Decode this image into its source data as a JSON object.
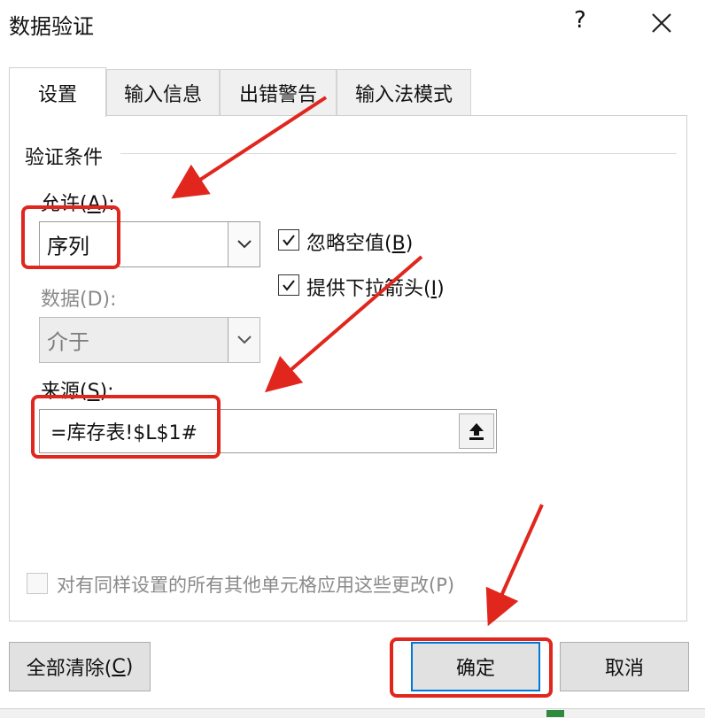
{
  "dialog": {
    "title": "数据验证",
    "help_label": "?"
  },
  "tabs": [
    {
      "label": "设置",
      "active": true
    },
    {
      "label": "输入信息",
      "active": false
    },
    {
      "label": "出错警告",
      "active": false
    },
    {
      "label": "输入法模式",
      "active": false
    }
  ],
  "validation": {
    "group_label": "验证条件",
    "allow": {
      "label_prefix": "允许(",
      "label_key": "A",
      "label_suffix": "):",
      "value": "序列"
    },
    "data": {
      "label": "数据(D):",
      "value": "介于"
    },
    "ignore_blank": {
      "label_prefix": "忽略空值(",
      "label_key": "B",
      "label_suffix": ")",
      "checked": true
    },
    "in_cell_dropdown": {
      "label_prefix": "提供下拉箭头(",
      "label_key": "I",
      "label_suffix": ")",
      "checked": true
    },
    "source": {
      "label_prefix": "来源(",
      "label_key": "S",
      "label_suffix": "):",
      "value": "=库存表!$L$1#"
    }
  },
  "apply_to_all": {
    "label": "对有同样设置的所有其他单元格应用这些更改(P)",
    "checked": false
  },
  "buttons": {
    "clear_all_prefix": "全部清除(",
    "clear_all_key": "C",
    "clear_all_suffix": ")",
    "ok": "确定",
    "cancel": "取消"
  },
  "colors": {
    "highlight": "#e0261d",
    "default_button_border": "#0078d7"
  }
}
